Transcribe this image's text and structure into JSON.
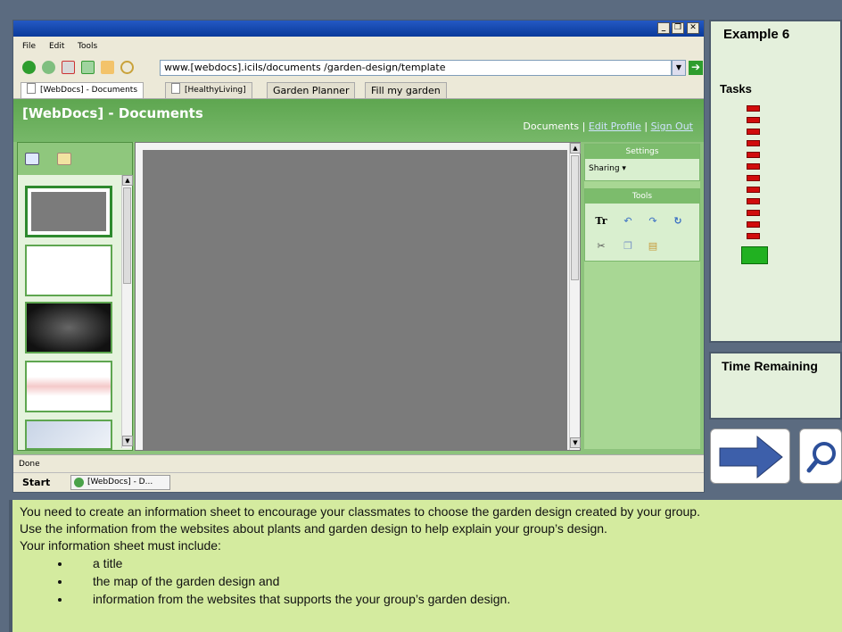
{
  "browser": {
    "menu": [
      "File",
      "Edit",
      "Tools"
    ],
    "address": "www.[webdocs].icils/documents /garden-design/template",
    "tabs": [
      {
        "label": "[WebDocs] - Documents"
      },
      {
        "label": "[HealthyLiving]"
      },
      {
        "label": "Garden Planner"
      },
      {
        "label": "Fill my garden"
      }
    ],
    "status": "Done",
    "taskbar": {
      "start": "Start",
      "item": "[WebDocs] - D..."
    }
  },
  "webpage": {
    "title": "[WebDocs] - Documents",
    "links": {
      "documents": "Documents",
      "edit_profile": "Edit Profile",
      "sign_out": "Sign Out"
    },
    "settings": {
      "header": "Settings",
      "sharing": "Sharing ▾"
    },
    "tools": {
      "header": "Tools"
    }
  },
  "task_panel": {
    "title": "Example 6",
    "tasks_label": "Tasks",
    "task_count": 13,
    "current_task": 13
  },
  "time_label": "Time Remaining",
  "instructions": {
    "line1": "You need to create an information  sheet to encourage your classmates to choose the garden design created by your group.",
    "line2": "Use the information  from the websites about plants and garden design to help explain your group’s design.",
    "line3": "Your information  sheet must include:",
    "bullets": [
      "a title",
      "the map of the garden design and",
      "information from the websites that supports the your group’s garden design."
    ]
  },
  "colors": {
    "task_incomplete": "#d10c0c",
    "task_current": "#21b121",
    "next_arrow": "#3d5faa",
    "page_green": "#5ea650"
  }
}
